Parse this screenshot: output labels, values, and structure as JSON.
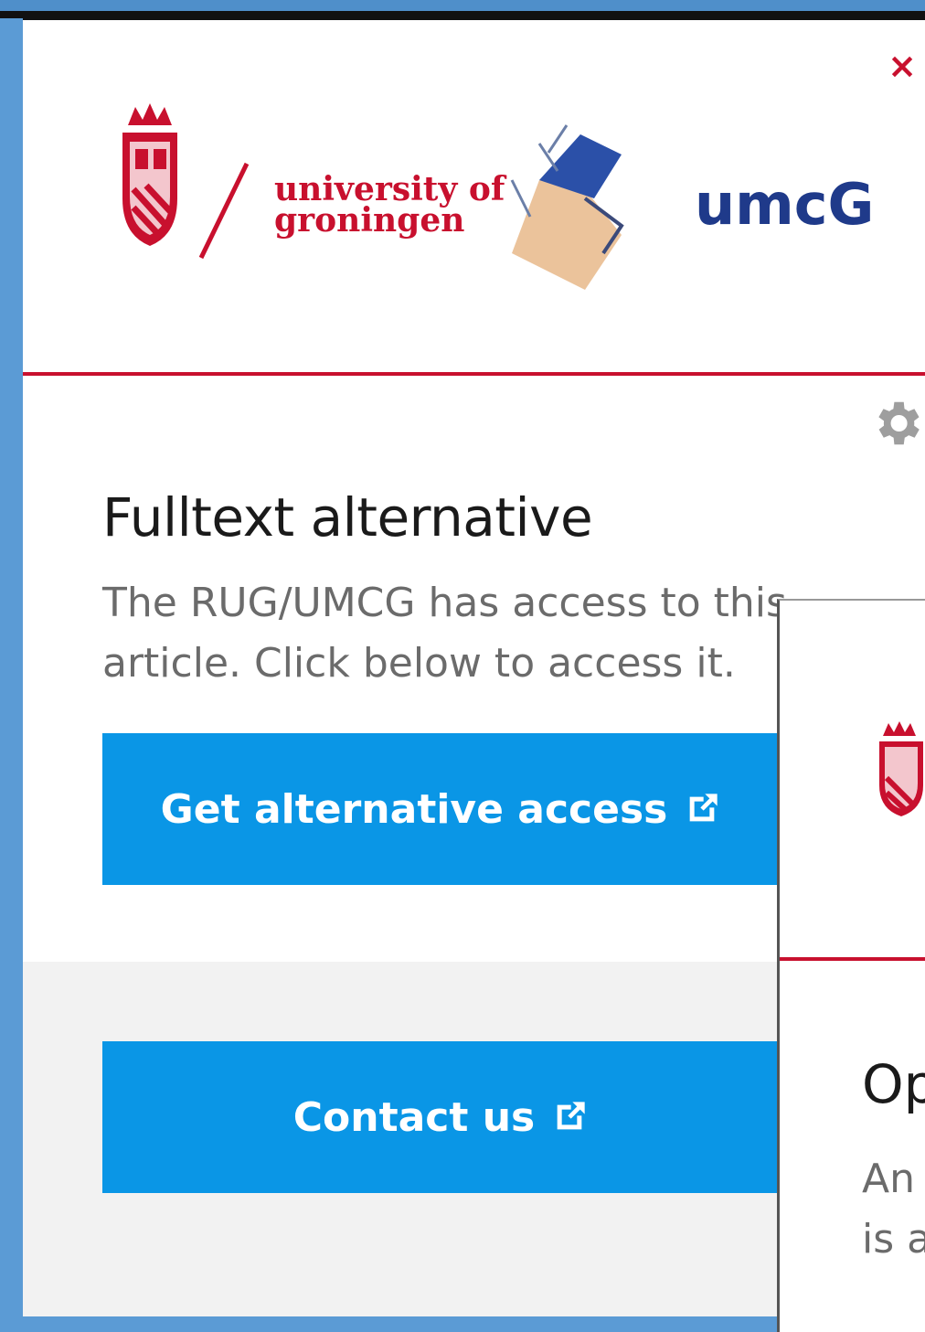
{
  "header": {
    "close_label": "×",
    "logo": {
      "university_text_line1": "university of",
      "university_text_line2": "groningen",
      "umcg_text": "umcG",
      "icon_name": "rug-umcg-logo"
    }
  },
  "main": {
    "settings_icon": "gear-icon",
    "title": "Fulltext alternative",
    "description": "The RUG/UMCG has access to this article. Click below to access it.",
    "access_button_label": "Get alternative access",
    "contact_button_label": "Contact us"
  },
  "overlay": {
    "title_partial": "Op",
    "description_line1": "An",
    "description_line2": "is a"
  },
  "colors": {
    "brand_red": "#c8102e",
    "button_blue": "#0a96e6",
    "umcg_blue": "#1f3a8a",
    "page_bg_blue": "#5b9bd5"
  }
}
